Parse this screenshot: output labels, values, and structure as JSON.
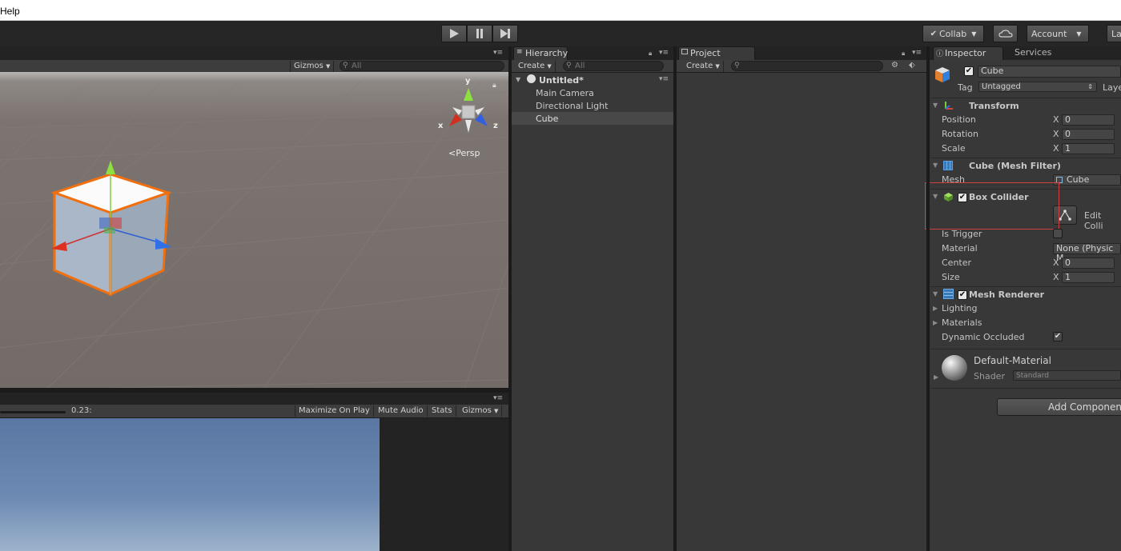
{
  "menubar": {
    "help": "Help"
  },
  "toolbar": {
    "collab": "Collab",
    "account": "Account",
    "layers": "La"
  },
  "scene": {
    "gizmos": "Gizmos",
    "search_placeholder": "All",
    "persp": "Persp",
    "axis_y": "y",
    "axis_x": "x",
    "axis_z": "z"
  },
  "game": {
    "scale_value": "0.23:",
    "maximize": "Maximize On Play",
    "mute": "Mute Audio",
    "stats": "Stats",
    "gizmos": "Gizmos"
  },
  "hierarchy": {
    "tab": "Hierarchy",
    "create": "Create",
    "search_placeholder": "All",
    "scene_name": "Untitled*",
    "items": [
      "Main Camera",
      "Directional Light",
      "Cube"
    ],
    "selected": "Cube"
  },
  "project": {
    "tab": "Project",
    "create": "Create"
  },
  "inspector": {
    "tab": "Inspector",
    "services_tab": "Services",
    "object_name": "Cube",
    "tag_label": "Tag",
    "tag_value": "Untagged",
    "layer_label": "Laye",
    "transform": {
      "title": "Transform",
      "position": "Position",
      "rotation": "Rotation",
      "scale": "Scale",
      "x_label": "X",
      "position_x": "0",
      "rotation_x": "0",
      "scale_x": "1"
    },
    "mesh_filter": {
      "title": "Cube (Mesh Filter)",
      "mesh_label": "Mesh",
      "mesh_value": "Cube"
    },
    "box_collider": {
      "title": "Box Collider",
      "edit_collider": "Edit Colli",
      "is_trigger": "Is Trigger",
      "material": "Material",
      "material_value": "None (Physic M",
      "center": "Center",
      "size": "Size",
      "x_label": "X",
      "center_x": "0",
      "size_x": "1"
    },
    "mesh_renderer": {
      "title": "Mesh Renderer",
      "lighting": "Lighting",
      "materials": "Materials",
      "dynamic_occluded": "Dynamic Occluded"
    },
    "material": {
      "name": "Default-Material",
      "shader_label": "Shader",
      "shader_value": "Standard"
    },
    "add_component": "Add Componen"
  },
  "colors": {
    "selection_box": "#d04040",
    "cube_outline": "#f07010",
    "panel_bg": "#383838"
  }
}
